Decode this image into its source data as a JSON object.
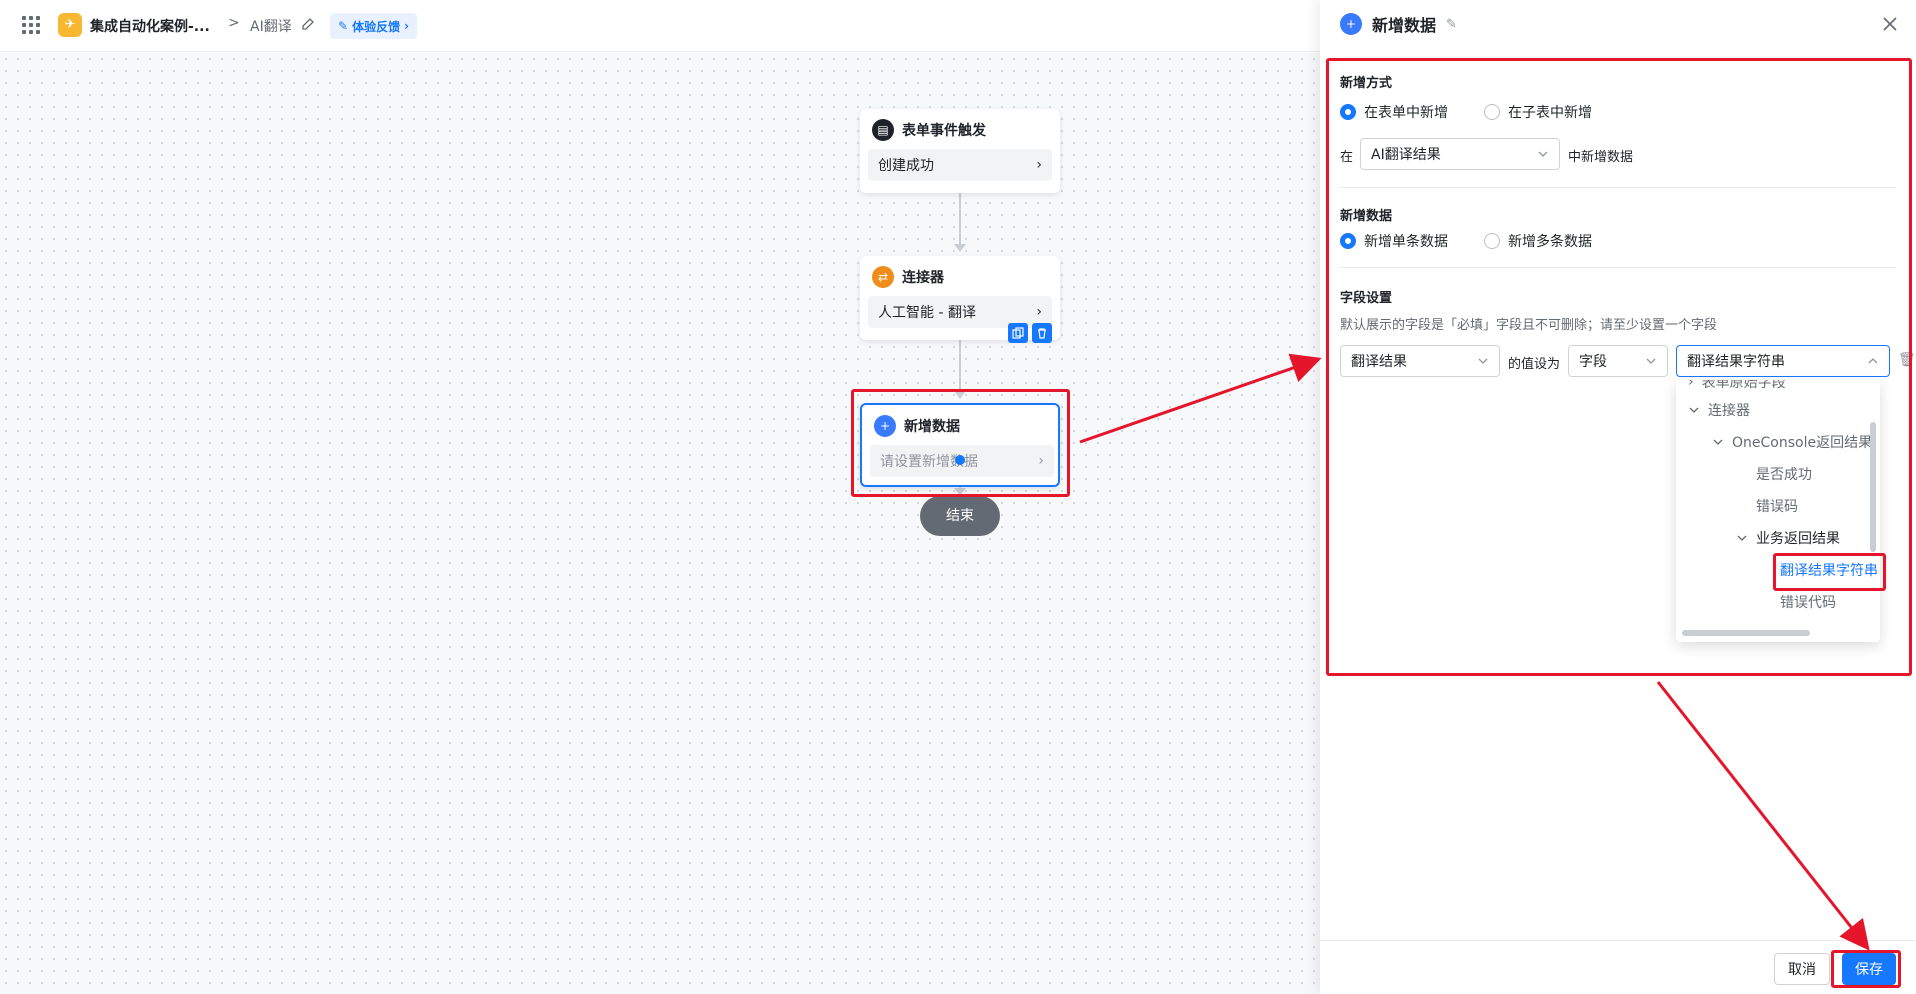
{
  "topbar": {
    "app_name": "集成自动化案例-...",
    "breadcrumb_separator": ">",
    "page_name": "AI翻译",
    "feedback_label": "体验反馈"
  },
  "canvas": {
    "nodes": [
      {
        "title": "表单事件触发",
        "value": "创建成功",
        "icon": "document-icon"
      },
      {
        "title": "连接器",
        "value": "人工智能 - 翻译",
        "icon": "connector-icon"
      },
      {
        "title": "新增数据",
        "value": "请设置新增数据",
        "icon": "plus-icon"
      }
    ],
    "end_label": "结束"
  },
  "panel": {
    "title": "新增数据",
    "add_mode": {
      "title": "新增方式",
      "options": [
        "在表单中新增",
        "在子表中新增"
      ],
      "selected": "在表单中新增",
      "prefix": "在",
      "target_form": "AI翻译结果",
      "suffix": "中新增数据"
    },
    "add_data": {
      "title": "新增数据",
      "options": [
        "新增单条数据",
        "新增多条数据"
      ],
      "selected": "新增单条数据"
    },
    "field_settings": {
      "title": "字段设置",
      "hint": "默认展示的字段是「必填」字段且不可删除；请至少设置一个字段",
      "field": "翻译结果",
      "value_as_label": "的值设为",
      "value_type": "字段",
      "value_field": "翻译结果字符串"
    },
    "dropdown_tree": [
      {
        "label": "表单原始字段",
        "level": 0
      },
      {
        "label": "连接器",
        "level": 0
      },
      {
        "label": "OneConsole返回结果",
        "level": 1
      },
      {
        "label": "是否成功",
        "level": 2
      },
      {
        "label": "错误码",
        "level": 2
      },
      {
        "label": "业务返回结果",
        "level": 2
      },
      {
        "label": "翻译结果字符串",
        "level": 3
      },
      {
        "label": "错误代码",
        "level": 3
      }
    ],
    "footer": {
      "cancel_label": "取消",
      "save_label": "保存"
    }
  },
  "colors": {
    "accent": "#1677ff",
    "annotation": "#e5152b"
  }
}
